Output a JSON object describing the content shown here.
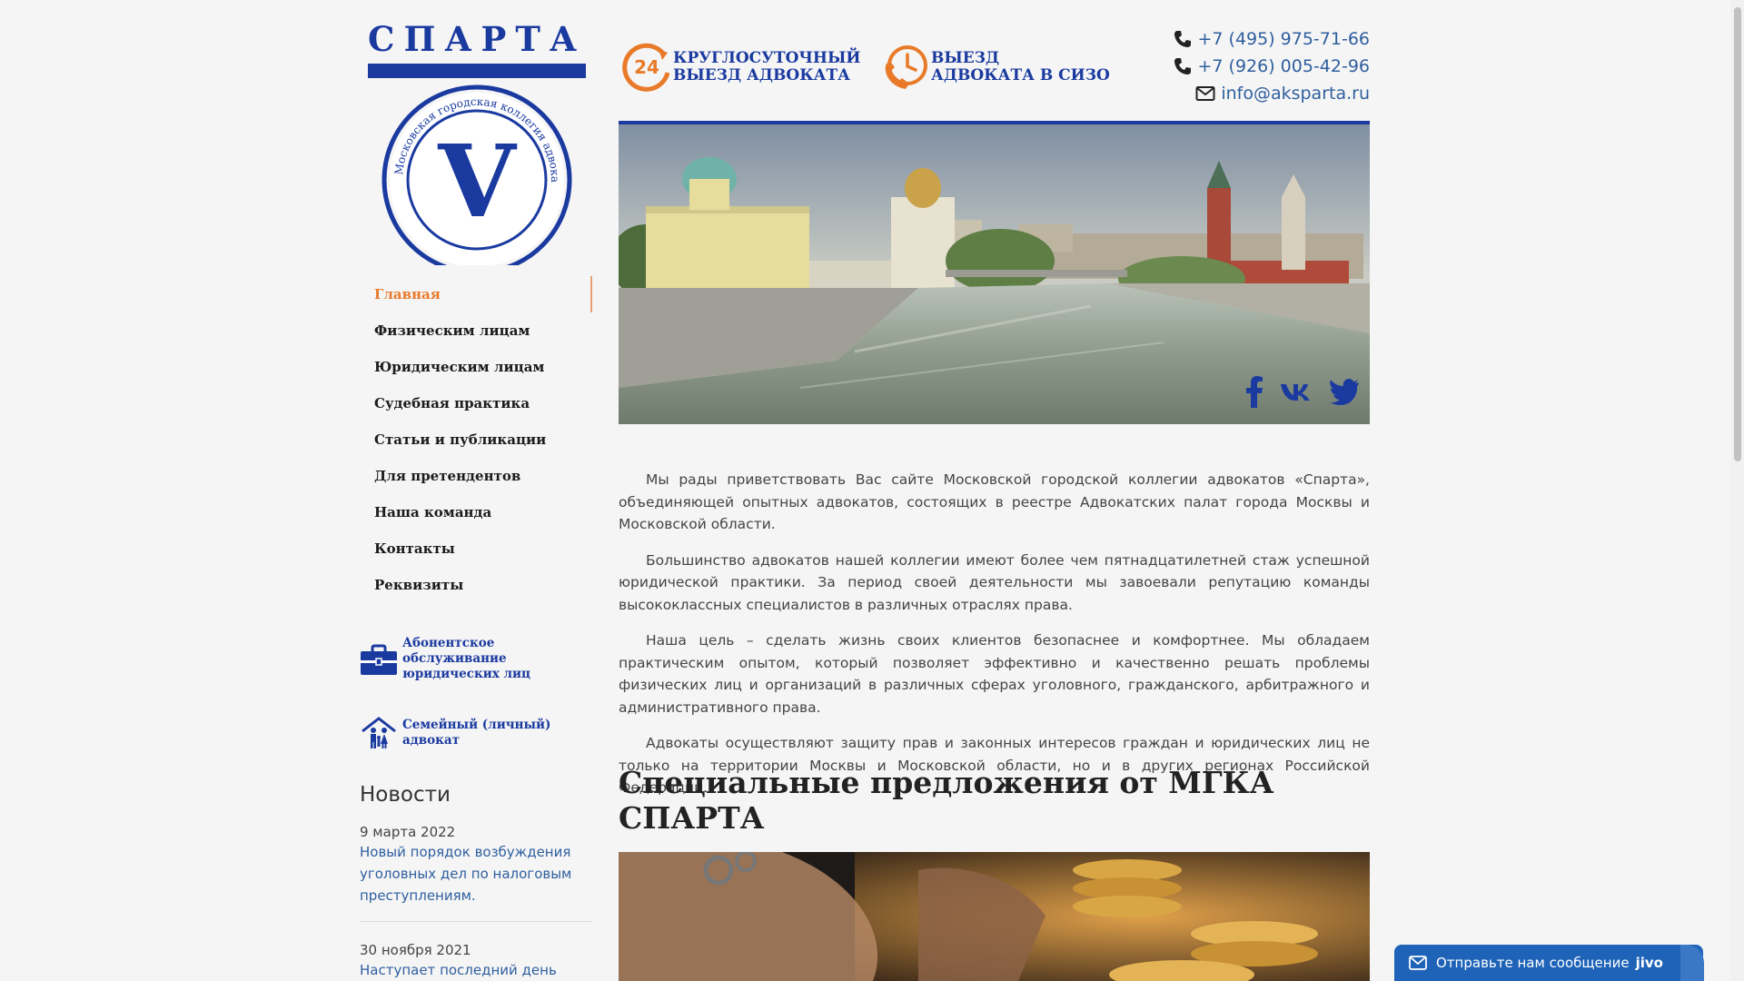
{
  "logo": {
    "title": "СПАРТА",
    "seal_text": "Московская городская коллегия адвокатов",
    "letter": "V"
  },
  "nav": {
    "items": [
      {
        "label": "Главная",
        "active": true
      },
      {
        "label": "Физическим лицам"
      },
      {
        "label": "Юридическим лицам"
      },
      {
        "label": "Судебная практика"
      },
      {
        "label": "Статьи и публикации"
      },
      {
        "label": "Для претендентов"
      },
      {
        "label": "Наша команда"
      },
      {
        "label": "Контакты"
      },
      {
        "label": "Реквизиты"
      }
    ]
  },
  "promos": [
    {
      "line1": "Абонентское обслуживание",
      "line2": "юридических лиц",
      "icon": "briefcase-icon"
    },
    {
      "line1": "Семейный (личный)",
      "line2": "адвокат",
      "icon": "family-house-icon"
    }
  ],
  "news": {
    "heading": "Новости",
    "items": [
      {
        "date": "9 марта 2022",
        "title": "Новый порядок возбуждения уголовных дел по налоговым преступлениям."
      },
      {
        "date": "30 ноября 2021",
        "title": "Наступает последний день уплаты"
      }
    ]
  },
  "header": {
    "badge1": {
      "badge_number": "24",
      "line1": "КРУГЛОСУТОЧНЫЙ",
      "line2": "ВЫЕЗД АДВОКАТА"
    },
    "badge2": {
      "line1": "ВЫЕЗД",
      "line2": "АДВОКАТА В СИЗО"
    },
    "phone1": "+7 (495) 975-71-66",
    "phone2": "+7 (926) 005-42-96",
    "email": "info@aksparta.ru"
  },
  "content": {
    "paragraphs": [
      "Мы рады приветствовать Вас сайте Московской городской коллегии адвокатов «Спарта», объединяющей опытных адвокатов, состоящих в реестре Адвокатских палат города Москвы и Московской области.",
      "Большинство адвокатов нашей коллегии имеют более чем пятнадцатилетней стаж успешной юридической практики. За период своей деятельности мы завоевали репутацию команды высококлассных специалистов в различных отраслях права.",
      "Наша цель – сделать жизнь своих клиентов безопаснее и комфортнее. Мы обладаем практическим опытом, который позволяет эффективно и качественно решать проблемы физических лиц и организаций в различных сферах уголовного, гражданского, арбитражного и административного права.",
      "Адвокаты осуществляют защиту прав и законных интересов граждан и юридических лиц не только на территории Москвы и Московской области, но и в других регионах Российской Федерации."
    ],
    "special_heading": "Специальные предложения от МГКА СПАРТА"
  },
  "chat": {
    "label": "Отправьте нам сообщение",
    "brand": "jivo"
  },
  "colors": {
    "brand_blue": "#1a3aa0",
    "accent_orange": "#e87a2a",
    "link_blue": "#2f5f9f"
  }
}
